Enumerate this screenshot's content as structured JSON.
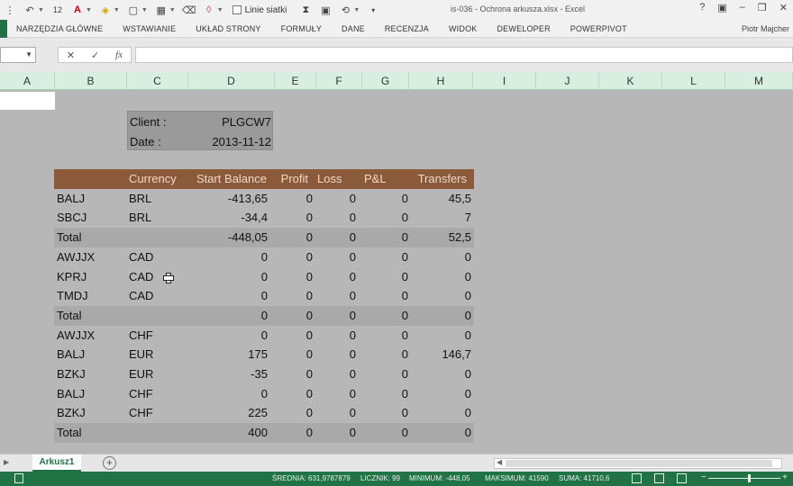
{
  "window": {
    "title": "is-036 - Ochrona arkusza.xlsx - Excel",
    "user": "Piotr Majcher"
  },
  "qat": {
    "gridlines_label": "Linie siatki",
    "font_size_label": "12"
  },
  "ribbon": {
    "tabs": [
      "NARZĘDZIA GŁÓWNE",
      "WSTAWIANIE",
      "UKŁAD STRONY",
      "FORMUŁY",
      "DANE",
      "RECENZJA",
      "WIDOK",
      "DEWELOPER",
      "POWERPIVOT"
    ]
  },
  "formula_bar": {
    "name_box": "",
    "formula": ""
  },
  "columns": [
    "A",
    "B",
    "C",
    "D",
    "E",
    "F",
    "G",
    "H",
    "I",
    "J",
    "K",
    "L",
    "M"
  ],
  "info": {
    "client_label": "Client :",
    "client_value": "PLGCW7",
    "date_label": "Date :",
    "date_value": "2013-11-12"
  },
  "table": {
    "headers": [
      "",
      "Currency",
      "Start Balance",
      "Profit",
      "Loss",
      "P&L",
      "Transfers"
    ],
    "rows": [
      {
        "code": "BALJ",
        "currency": "BRL",
        "start": "-413,65",
        "profit": "0",
        "loss": "0",
        "pl": "0",
        "transfers": "45,5",
        "total": false
      },
      {
        "code": "SBCJ",
        "currency": "BRL",
        "start": "-34,4",
        "profit": "0",
        "loss": "0",
        "pl": "0",
        "transfers": "7",
        "total": false
      },
      {
        "code": "Total",
        "currency": "",
        "start": "-448,05",
        "profit": "0",
        "loss": "0",
        "pl": "0",
        "transfers": "52,5",
        "total": true
      },
      {
        "code": "AWJJX",
        "currency": "CAD",
        "start": "0",
        "profit": "0",
        "loss": "0",
        "pl": "0",
        "transfers": "0",
        "total": false
      },
      {
        "code": "KPRJ",
        "currency": "CAD",
        "start": "0",
        "profit": "0",
        "loss": "0",
        "pl": "0",
        "transfers": "0",
        "total": false
      },
      {
        "code": "TMDJ",
        "currency": "CAD",
        "start": "0",
        "profit": "0",
        "loss": "0",
        "pl": "0",
        "transfers": "0",
        "total": false
      },
      {
        "code": "Total",
        "currency": "",
        "start": "0",
        "profit": "0",
        "loss": "0",
        "pl": "0",
        "transfers": "0",
        "total": true
      },
      {
        "code": "AWJJX",
        "currency": "CHF",
        "start": "0",
        "profit": "0",
        "loss": "0",
        "pl": "0",
        "transfers": "0",
        "total": false
      },
      {
        "code": "BALJ",
        "currency": "EUR",
        "start": "175",
        "profit": "0",
        "loss": "0",
        "pl": "0",
        "transfers": "146,7",
        "total": false
      },
      {
        "code": "BZKJ",
        "currency": "EUR",
        "start": "-35",
        "profit": "0",
        "loss": "0",
        "pl": "0",
        "transfers": "0",
        "total": false
      },
      {
        "code": "BALJ",
        "currency": "CHF",
        "start": "0",
        "profit": "0",
        "loss": "0",
        "pl": "0",
        "transfers": "0",
        "total": false
      },
      {
        "code": "BZKJ",
        "currency": "CHF",
        "start": "225",
        "profit": "0",
        "loss": "0",
        "pl": "0",
        "transfers": "0",
        "total": false
      },
      {
        "code": "Total",
        "currency": "",
        "start": "400",
        "profit": "0",
        "loss": "0",
        "pl": "0",
        "transfers": "0",
        "total": true
      }
    ]
  },
  "sheets": {
    "active": "Arkusz1"
  },
  "status": {
    "average": "ŚREDNIA: 631,9787879",
    "count": "LICZNIK: 99",
    "minimum": "MINIMUM: -448,05",
    "maximum": "MAKSIMUM: 41590",
    "sum": "SUMA: 41710,6"
  },
  "colors": {
    "accent": "#217346",
    "header_row": "#8a5a3a",
    "sheet_bg": "#b7b7b7"
  },
  "icons": [
    "undo-icon",
    "fill-color-icon",
    "font-color-icon",
    "borders-icon",
    "eraser-icon",
    "hourglass-icon",
    "camera-icon",
    "help-icon",
    "restore-icon",
    "close-icon",
    "add-sheet-icon"
  ]
}
